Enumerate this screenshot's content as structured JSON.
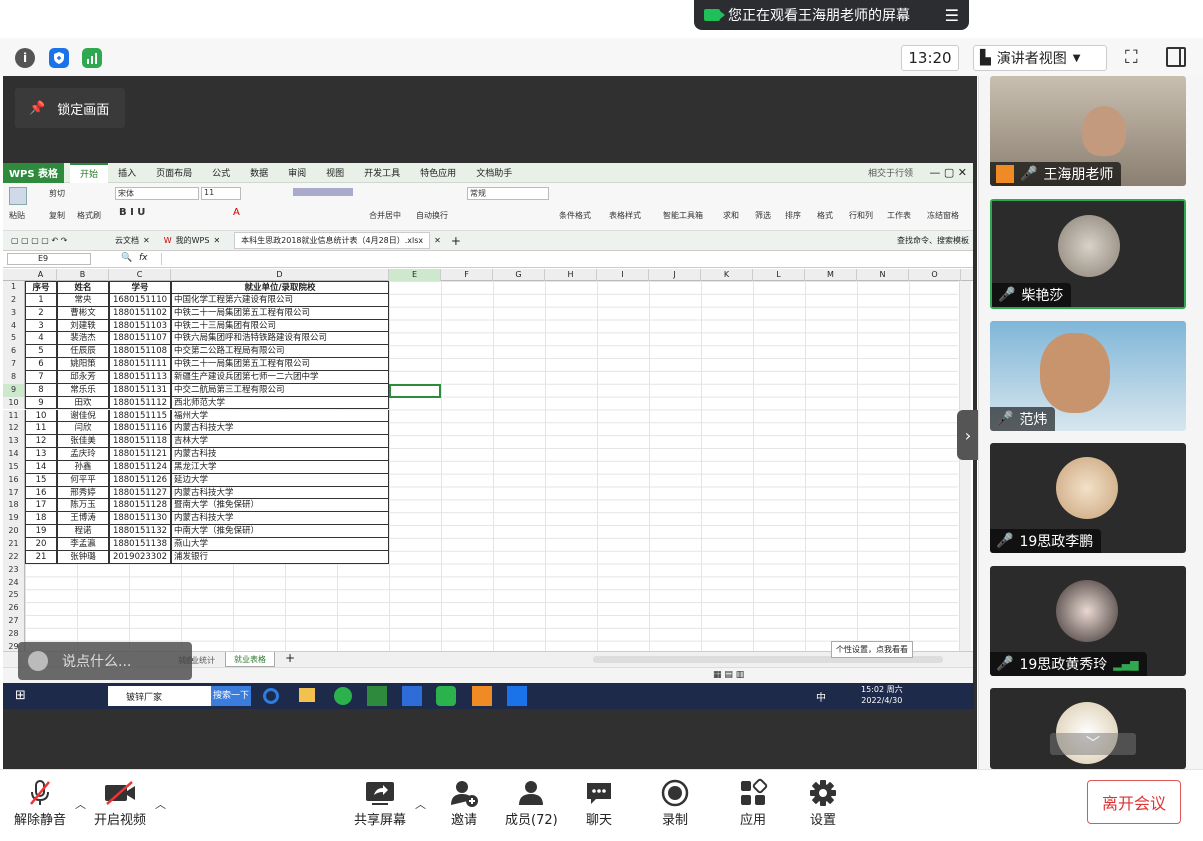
{
  "banner": {
    "text": "您正在观看王海朋老师的屏幕"
  },
  "status": {
    "time": "13:20",
    "view_mode": "演讲者视图"
  },
  "share": {
    "lock_label": "锁定画面",
    "chat_placeholder": "说点什么...",
    "wps": {
      "app_name": "WPS 表格",
      "menu_tabs": [
        "开始",
        "插入",
        "页面布局",
        "公式",
        "数据",
        "审阅",
        "视图",
        "开发工具",
        "特色应用",
        "文档助手"
      ],
      "active_tab": "开始",
      "title_right": "相交于行领",
      "ribbon": {
        "paste": "粘贴",
        "cut": "剪切",
        "copy": "复制",
        "format_painter": "格式刷",
        "font": "宋体",
        "size": "11",
        "merge": "合并居中",
        "wrap": "自动换行",
        "number_format": "常规",
        "cond_format": "条件格式",
        "table_style": "表格样式",
        "smart_tool": "智能工具箱",
        "sum": "求和",
        "filter": "筛选",
        "sort": "排序",
        "format": "格式",
        "rowcol": "行和列",
        "worksheet": "工作表",
        "freeze": "冻结窗格"
      },
      "doc_tabs": [
        "云文档",
        "我的WPS",
        "本科生思政2018就业信息统计表（4月28日）.xlsx"
      ],
      "search_hint": "查找命令、搜索模板",
      "name_box": "E9",
      "fx": "fx",
      "col_letters": [
        "A",
        "B",
        "C",
        "D",
        "E",
        "F",
        "G",
        "H",
        "I",
        "J",
        "K",
        "L",
        "M",
        "N",
        "O"
      ],
      "headers": [
        "序号",
        "姓名",
        "学号",
        "就业单位/录取院校"
      ],
      "rows": [
        [
          "1",
          "常央",
          "1680151110",
          "中国化学工程第六建设有限公司"
        ],
        [
          "2",
          "曹彬文",
          "1880151102",
          "中铁二十一局集团第五工程有限公司"
        ],
        [
          "3",
          "刘建轶",
          "1880151103",
          "中铁二十三局集团有限公司"
        ],
        [
          "4",
          "裴浩杰",
          "1880151107",
          "中铁六局集团呼和浩特铁路建设有限公司"
        ],
        [
          "5",
          "任辰辰",
          "1880151108",
          "中交第二公路工程局有限公司"
        ],
        [
          "6",
          "姚阳策",
          "1880151111",
          "中铁二十一局集团第五工程有限公司"
        ],
        [
          "7",
          "邱永芳",
          "1880151113",
          "新疆生产建设兵团第七师一二六团中学"
        ],
        [
          "8",
          "常乐乐",
          "1880151131",
          "中交二航局第三工程有限公司"
        ],
        [
          "9",
          "田欢",
          "1880151112",
          "西北师范大学"
        ],
        [
          "10",
          "谢佳倪",
          "1880151115",
          "福州大学"
        ],
        [
          "11",
          "闫欣",
          "1880151116",
          "内蒙古科技大学"
        ],
        [
          "12",
          "张佳美",
          "1880151118",
          "吉林大学"
        ],
        [
          "13",
          "孟庆玲",
          "1880151121",
          "内蒙古科技"
        ],
        [
          "14",
          "孙鑫",
          "1880151124",
          "黑龙江大学"
        ],
        [
          "15",
          "何平平",
          "1880151126",
          "延边大学"
        ],
        [
          "16",
          "邢秀婷",
          "1880151127",
          "内蒙古科技大学"
        ],
        [
          "17",
          "陈万玉",
          "1880151128",
          "暨南大学（推免保研）"
        ],
        [
          "18",
          "王博涛",
          "1880151130",
          "内蒙古科技大学"
        ],
        [
          "19",
          "程诺",
          "1880151132",
          "中南大学（推免保研）"
        ],
        [
          "20",
          "李孟瀛",
          "1880151138",
          "燕山大学"
        ],
        [
          "21",
          "张钟璐",
          "2019023302",
          "浦发银行"
        ]
      ],
      "row_numbers": [
        "1",
        "2",
        "3",
        "4",
        "5",
        "6",
        "7",
        "8",
        "9",
        "10",
        "11",
        "12",
        "13",
        "14",
        "15",
        "16",
        "17",
        "18",
        "19",
        "20",
        "21",
        "22",
        "23",
        "24",
        "25",
        "26",
        "27",
        "28",
        "29"
      ],
      "sheet_tabs": [
        "就业",
        "就业统计",
        "就业表格"
      ],
      "tooltip": "个性设置，点我看看",
      "taskbar": {
        "search_text": "铍锌厂家",
        "search_btn": "搜索一下",
        "clock_time": "15:02 周六",
        "clock_date": "2022/4/30",
        "ime": "中"
      }
    }
  },
  "participants": [
    {
      "name": "王海朋老师"
    },
    {
      "name": "柴艳莎"
    },
    {
      "name": "范炜"
    },
    {
      "name": "19思政李鹏"
    },
    {
      "name": "19思政黄秀玲"
    }
  ],
  "toolbar": {
    "mute": "解除静音",
    "video": "开启视频",
    "share": "共享屏幕",
    "invite": "邀请",
    "members": "成员(72)",
    "chat": "聊天",
    "record": "录制",
    "apps": "应用",
    "settings": "设置",
    "leave": "离开会议"
  }
}
